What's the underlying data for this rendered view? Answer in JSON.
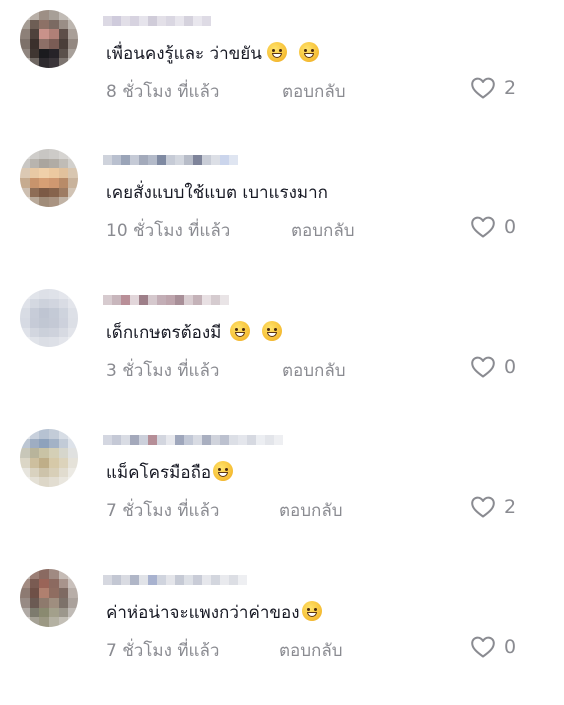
{
  "comments": [
    {
      "text": "เพื่อนคงรู้และ ว่าขยัน",
      "emoji": [
        "sweat-smile-emoji",
        "sweat-smile-emoji"
      ],
      "time": "8 ชั่วโมง ที่แล้ว",
      "reply": "ตอบกลับ",
      "likes": "2"
    },
    {
      "text": "เคยสั่งแบบใช้แบต เบาแรงมาก",
      "emoji": [],
      "time": "10 ชั่วโมง ที่แล้ว",
      "reply": "ตอบกลับ",
      "likes": "0"
    },
    {
      "text": "เด็กเกษตรต้องมี",
      "emoji": [
        "grin-emoji",
        "grin-emoji"
      ],
      "time": "3 ชั่วโมง ที่แล้ว",
      "reply": "ตอบกลับ",
      "likes": "0"
    },
    {
      "text": "แม็คโครมือถือ",
      "emoji": [
        "tears-of-joy-emoji"
      ],
      "time": "7 ชั่วโมง ที่แล้ว",
      "reply": "ตอบกลับ",
      "likes": "2"
    },
    {
      "text": "ค่าห่อน่าจะแพงกว่าค่าของ",
      "emoji": [
        "tears-of-joy-emoji"
      ],
      "time": "7 ชั่วโมง ที่แล้ว",
      "reply": "ตอบกลับ",
      "likes": "0"
    }
  ],
  "icons": {
    "like": "heart-outline-icon"
  },
  "colors": {
    "text": "#161823",
    "secondary": "#8a8b91"
  }
}
